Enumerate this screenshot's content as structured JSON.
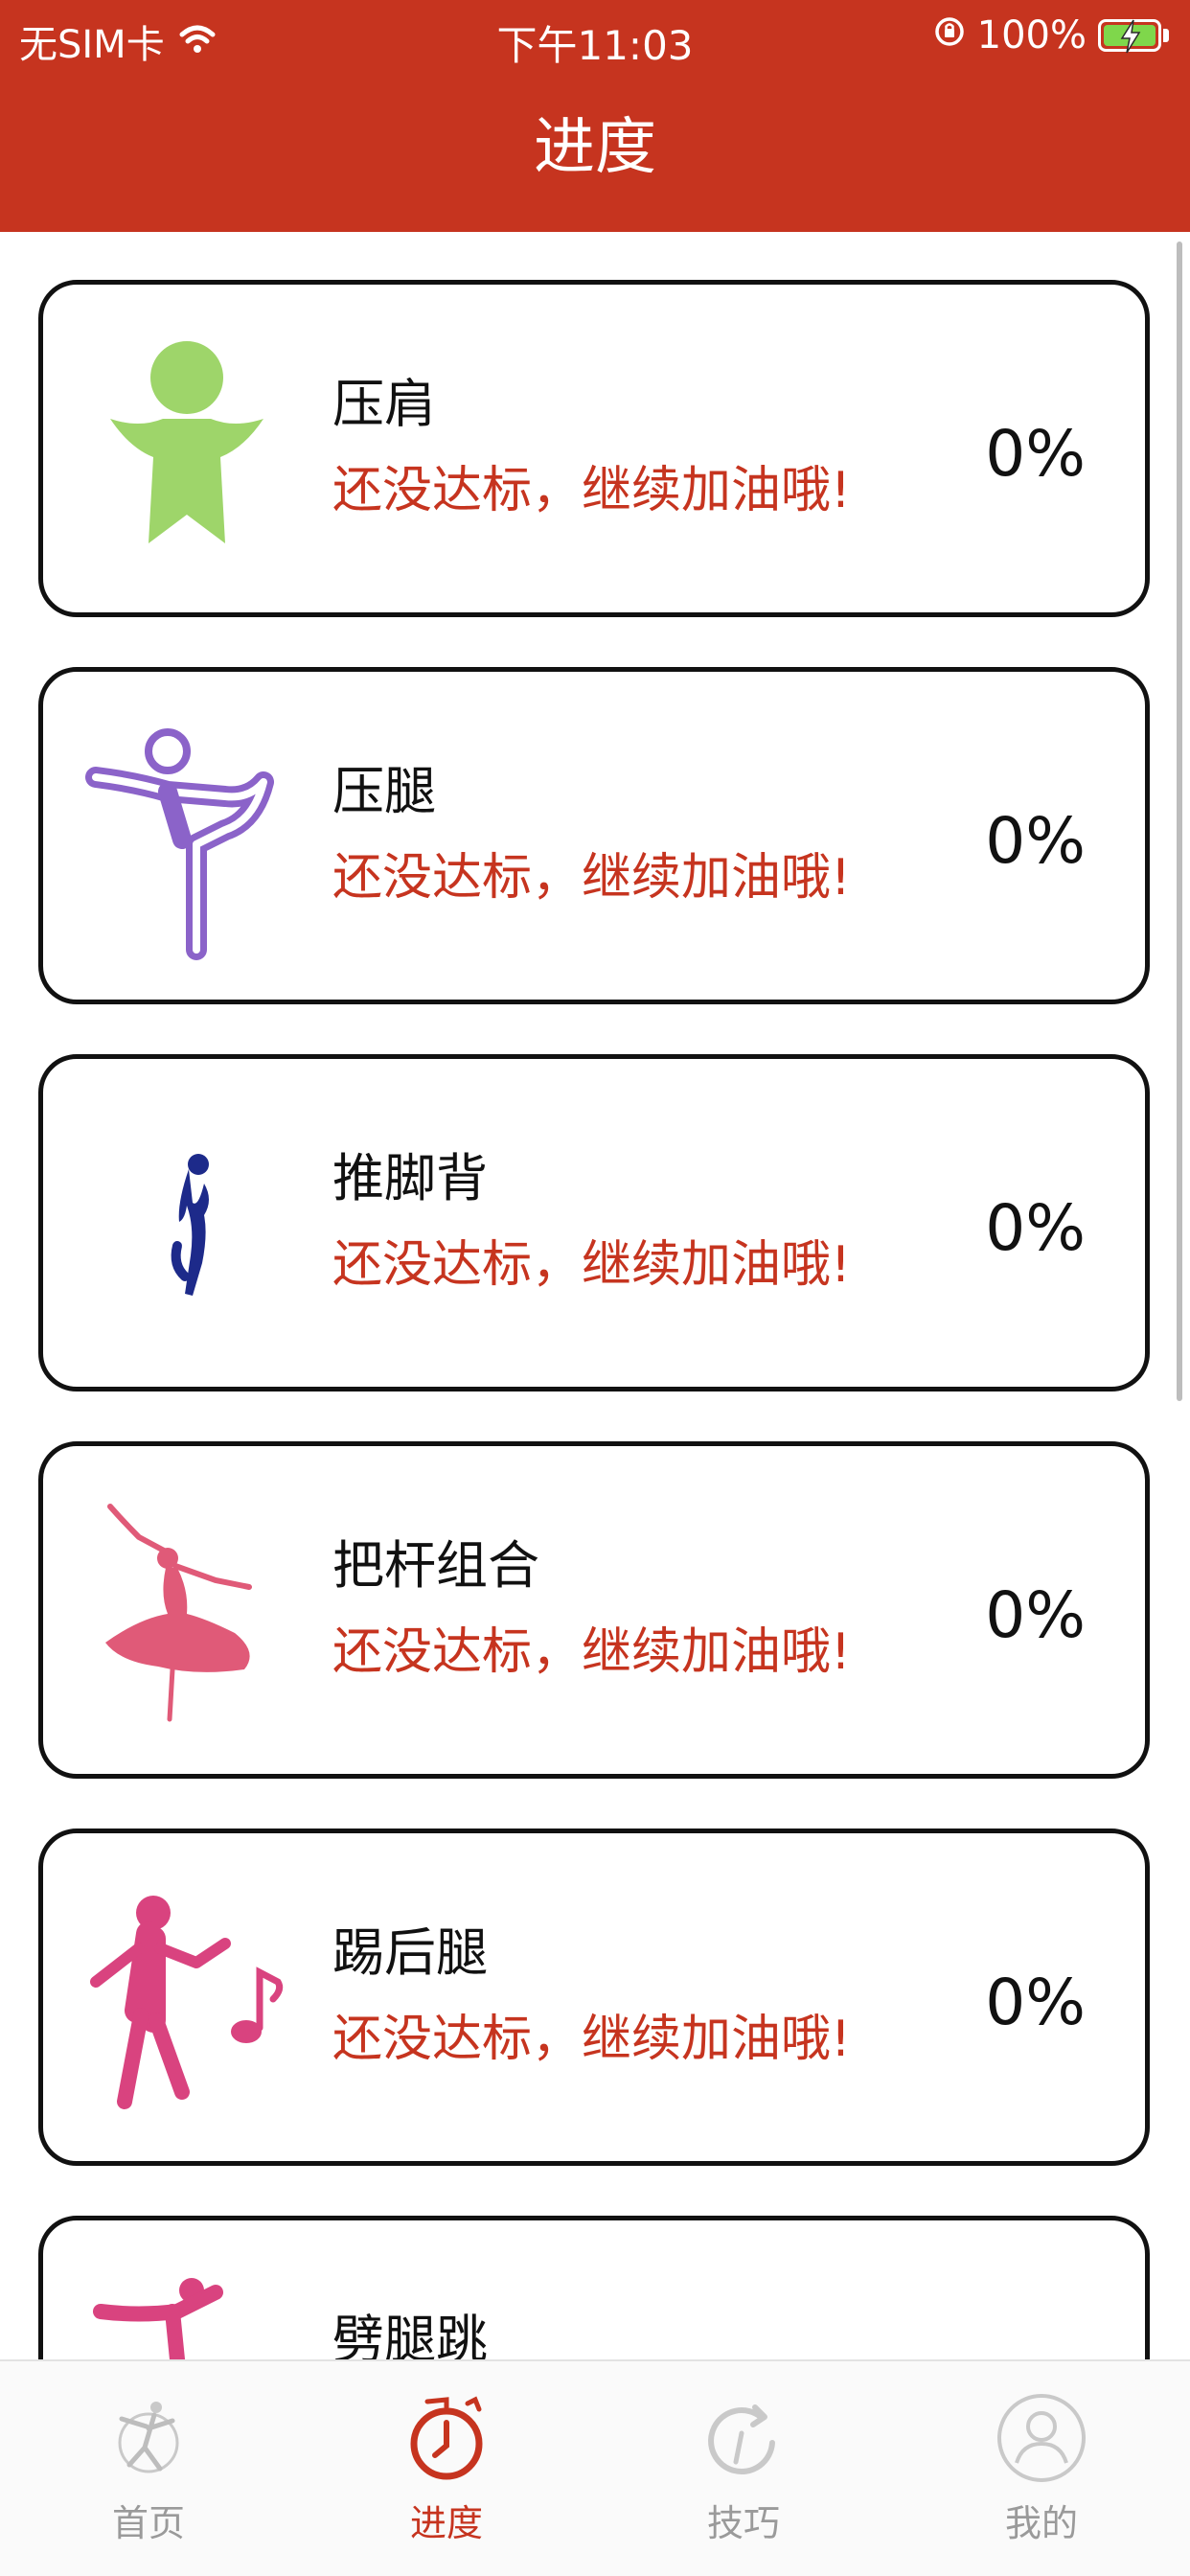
{
  "status_bar": {
    "carrier": "无SIM卡",
    "time": "下午11:03",
    "battery": "100%"
  },
  "header": {
    "title": "进度"
  },
  "items": [
    {
      "name": "压肩",
      "status": "还没达标，继续加油哦!",
      "percent": "0%",
      "icon": "dance-figure-green-icon",
      "color": "#9ed56a"
    },
    {
      "name": "压腿",
      "status": "还没达标，继续加油哦!",
      "percent": "0%",
      "icon": "leg-stretch-figure-icon",
      "color": "#8b63c9"
    },
    {
      "name": "推脚背",
      "status": "还没达标，继续加油哦!",
      "percent": "0%",
      "icon": "jumping-figure-icon",
      "color": "#1d2a8a"
    },
    {
      "name": "把杆组合",
      "status": "还没达标，继续加油哦!",
      "percent": "0%",
      "icon": "ballerina-figure-icon",
      "color": "#e05a78"
    },
    {
      "name": "踢后腿",
      "status": "还没达标，继续加油哦!",
      "percent": "0%",
      "icon": "dancing-music-figure-icon",
      "color": "#d9437f"
    },
    {
      "name": "劈腿跳",
      "status": "",
      "percent": "",
      "icon": "split-jump-figure-icon",
      "color": "#d9437f"
    }
  ],
  "tabbar": {
    "tabs": [
      {
        "label": "首页",
        "icon": "home-dancer-icon"
      },
      {
        "label": "进度",
        "icon": "progress-clock-icon"
      },
      {
        "label": "技巧",
        "icon": "tips-refresh-icon"
      },
      {
        "label": "我的",
        "icon": "profile-person-icon"
      }
    ],
    "active_index": 1
  },
  "colors": {
    "brand": "#c6341f",
    "inactive": "#9a9a9a"
  }
}
